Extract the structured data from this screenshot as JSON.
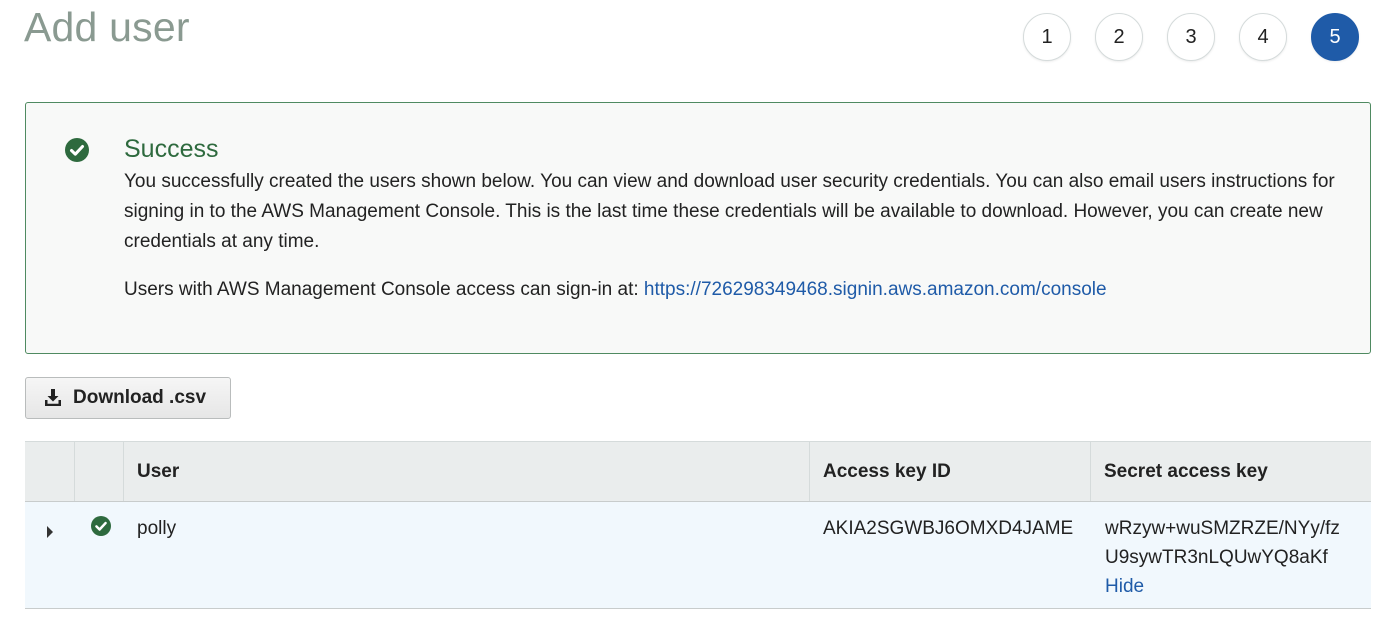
{
  "page": {
    "title": "Add user"
  },
  "steps": [
    "1",
    "2",
    "3",
    "4",
    "5"
  ],
  "active_step": "5",
  "alert": {
    "title": "Success",
    "body": "You successfully created the users shown below. You can view and download user security credentials. You can also email users instructions for signing in to the AWS Management Console. This is the last time these credentials will be available to download. However, you can create new credentials at any time.",
    "signin_prefix": "Users with AWS Management Console access can sign-in at: ",
    "signin_url": "https://726298349468.signin.aws.amazon.com/console"
  },
  "download_button": {
    "label": "Download .csv"
  },
  "table": {
    "columns": [
      "User",
      "Access key ID",
      "Secret access key"
    ],
    "rows": [
      {
        "user": "polly",
        "access_key_id": "AKIA2SGWBJ6OMXD4JAME",
        "secret_access_key": "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",
        "hide_label": "Hide"
      }
    ]
  },
  "colors": {
    "success": "#2e6a3e",
    "link": "#1f5ba8",
    "active_step": "#1f5ba8"
  }
}
